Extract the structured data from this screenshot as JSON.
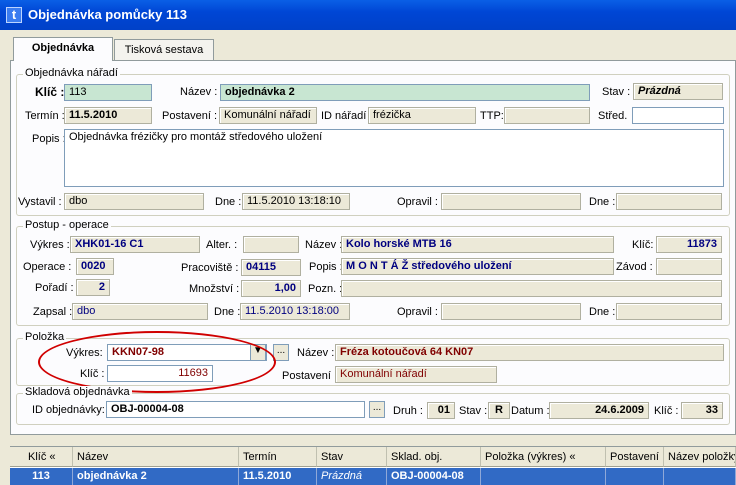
{
  "window": {
    "icon_letter": "t",
    "title": "Objednávka pomůcky 113"
  },
  "tabs": [
    "Objednávka",
    "Tisková sestava"
  ],
  "order": {
    "group_title": "Objednávka nářadí",
    "key_label": "Klíč :",
    "key_value": "113",
    "name_label": "Název :",
    "name_value": "objednávka 2",
    "state_label": "Stav :",
    "state_value": "Prázdná",
    "term_label": "Termín :",
    "term_value": "11.5.2010",
    "placement_label": "Postavení :",
    "placement_value": "Komunální nářadí",
    "tool_id_label": "ID nářadí :",
    "tool_id_value": "frézička",
    "ttp_label": "TTP:",
    "ttp_value": "",
    "center_label": "Střed.",
    "center_value": "",
    "desc_label": "Popis :",
    "desc_value": "Objednávka frézičky pro montáž středového uložení",
    "issued_label": "Vystavil :",
    "issued_value": "dbo",
    "date_label": "Dne :",
    "date_value": "11.5.2010 13:18:10",
    "corrected_label": "Opravil :",
    "corrected_value": "",
    "date2_label": "Dne :",
    "date2_value": ""
  },
  "procedure": {
    "group_title": "Postup - operace",
    "drawing_label": "Výkres :",
    "drawing_value": "XHK01-16 C1",
    "alter_label": "Alter. :",
    "alter_value": "",
    "name_label": "Název :",
    "name_value": "Kolo horské MTB 16",
    "key_label": "Klíč:",
    "key_value": "11873",
    "operation_label": "Operace :",
    "operation_value": "0020",
    "workplace_label": "Pracoviště :",
    "workplace_value": "04115",
    "desc_label": "Popis :",
    "desc_value": "M O N T Á Ž středového uložení",
    "plant_label": "Závod :",
    "plant_value": "",
    "order_label": "Pořadí :",
    "order_value": "2",
    "qty_label": "Množství :",
    "qty_value": "1,00",
    "note_label": "Pozn. :",
    "note_value": "",
    "written_label": "Zapsal :",
    "written_value": "dbo",
    "date_label": "Dne :",
    "date_value": "11.5.2010 13:18:00",
    "corrected_label": "Opravil :",
    "corrected_value": "",
    "date2_label": "Dne :",
    "date2_value": ""
  },
  "item": {
    "group_title": "Položka",
    "drawing_label": "Výkres:",
    "drawing_value": "KKN07-98",
    "ellipsis": "...",
    "name_label": "Název :",
    "name_value": "Fréza kotoučová 64 KN07",
    "key_label": "Klíč :",
    "key_value": "11693",
    "placement_label": "Postavení :",
    "placement_value": "Komunální nářadí"
  },
  "warehouse": {
    "group_title": "Skladová objednávka",
    "id_label": "ID objednávky:",
    "id_value": "OBJ-00004-08",
    "ellipsis": "...",
    "kind_label": "Druh :",
    "kind_value": "01",
    "state_label": "Stav :",
    "state_value": "R",
    "date_label": "Datum :",
    "date_value": "24.6.2009",
    "key_label": "Klíč :",
    "key_value": "33"
  },
  "grid": {
    "columns": [
      "Klíč «",
      "Název",
      "Termín",
      "Stav",
      "Sklad. obj.",
      "Položka (výkres) «",
      "Postavení",
      "Název položky"
    ],
    "rows": [
      [
        "113",
        "objednávka 2",
        "11.5.2010",
        "Prázdná",
        "OBJ-00004-08",
        "",
        "",
        ""
      ]
    ]
  },
  "colors": {
    "titlebar": "#0046d5",
    "highlight_oval": "#d00000",
    "selected_row": "#316ac5"
  }
}
